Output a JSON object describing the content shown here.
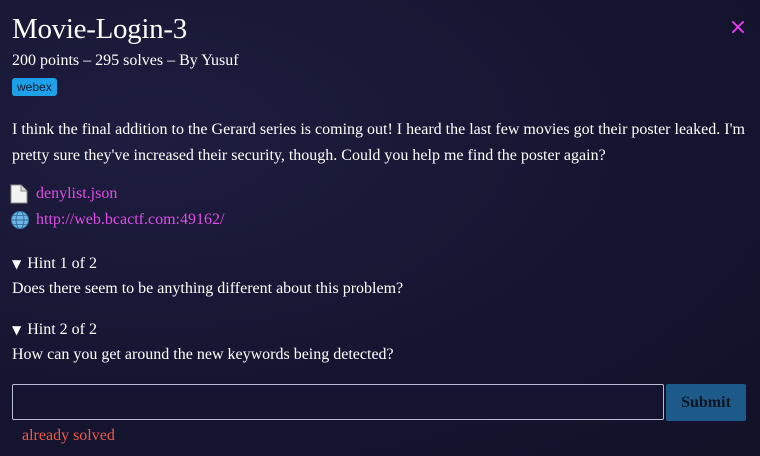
{
  "challenge": {
    "title": "Movie-Login-3",
    "meta": "200 points – 295 solves – By Yusuf",
    "tag": "webex",
    "description": "I think the final addition to the Gerard series is coming out! I heard the last few movies got their poster leaked. I'm pretty sure they've increased their security, though. Could you help me find the poster again?",
    "close_glyph": "×"
  },
  "files": [
    {
      "icon": "file-icon",
      "label": "denylist.json"
    },
    {
      "icon": "globe-icon",
      "label": "http://web.bcactf.com:49162/"
    }
  ],
  "hints": [
    {
      "header": "Hint 1 of 2",
      "body": "Does there seem to be anything different about this problem?"
    },
    {
      "header": "Hint 2 of 2",
      "body": "How can you get around the new keywords being detected?"
    }
  ],
  "form": {
    "input_value": "",
    "submit_label": "Submit",
    "status": "already solved"
  },
  "colors": {
    "background": "#171633",
    "link": "#e04ce6",
    "close": "#e83cf0",
    "tag": "#1ea0e8",
    "submit": "#1c5a8a",
    "status": "#ee5a48"
  }
}
